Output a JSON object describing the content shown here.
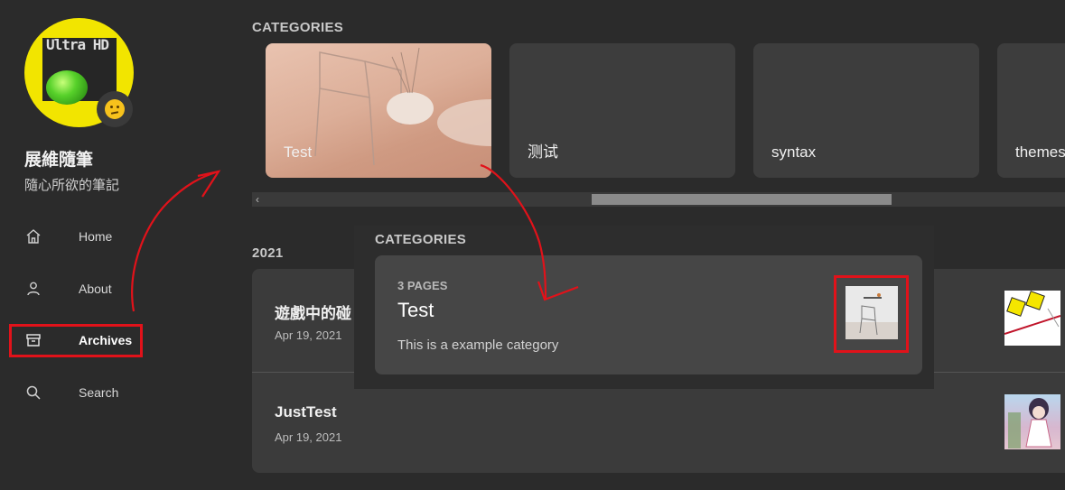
{
  "sidebar": {
    "avatar_text": "Ultra HD",
    "site_title": "展維隨筆",
    "site_subtitle": "隨心所欲的筆記",
    "nav": [
      {
        "label": "Home",
        "icon": "home-icon"
      },
      {
        "label": "About",
        "icon": "user-icon"
      },
      {
        "label": "Archives",
        "icon": "archive-icon"
      },
      {
        "label": "Search",
        "icon": "search-icon"
      }
    ]
  },
  "categories_header": "CATEGORIES",
  "categories": [
    "Test",
    "测试",
    "syntax",
    "themes"
  ],
  "archive_year": "2021",
  "posts": [
    {
      "title": "遊戲中的碰",
      "date": "Apr 19, 2021"
    },
    {
      "title": "JustTest",
      "date": "Apr 19, 2021"
    }
  ],
  "popup": {
    "header": "CATEGORIES",
    "count": "3 PAGES",
    "title": "Test",
    "description": "This is a example category"
  },
  "colors": {
    "background": "#2b2b2b",
    "card": "#3d3d3d",
    "highlight": "#e1121a",
    "avatar": "#f2e500"
  }
}
